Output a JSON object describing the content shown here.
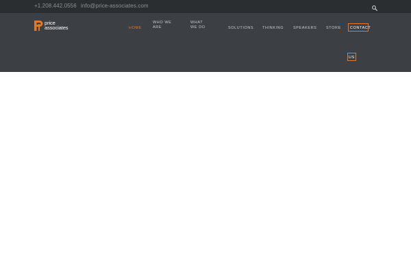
{
  "topbar": {
    "phone": "+1.208.442.0556",
    "email": "info@price-associates.com",
    "search_icon": "search-icon"
  },
  "logo": {
    "line1": "price",
    "line2": "associates",
    "mark_icon": "price-associates-logo-mark",
    "brand_color": "#e07b2b"
  },
  "nav": {
    "home": "HOME",
    "who_we_are": "WHO WE ARE",
    "what_we_do": "WHAT WE DO",
    "solutions": "SOLUTIONS",
    "thinking": "THINKING",
    "speakers": "SPEAKERS",
    "store": "STORE",
    "contact_line1": "CONTACT",
    "contact_line2": "US"
  },
  "colors": {
    "topbar_bg": "#2b2e31",
    "header_bg": "#3c4045",
    "accent": "#e07b2b"
  }
}
